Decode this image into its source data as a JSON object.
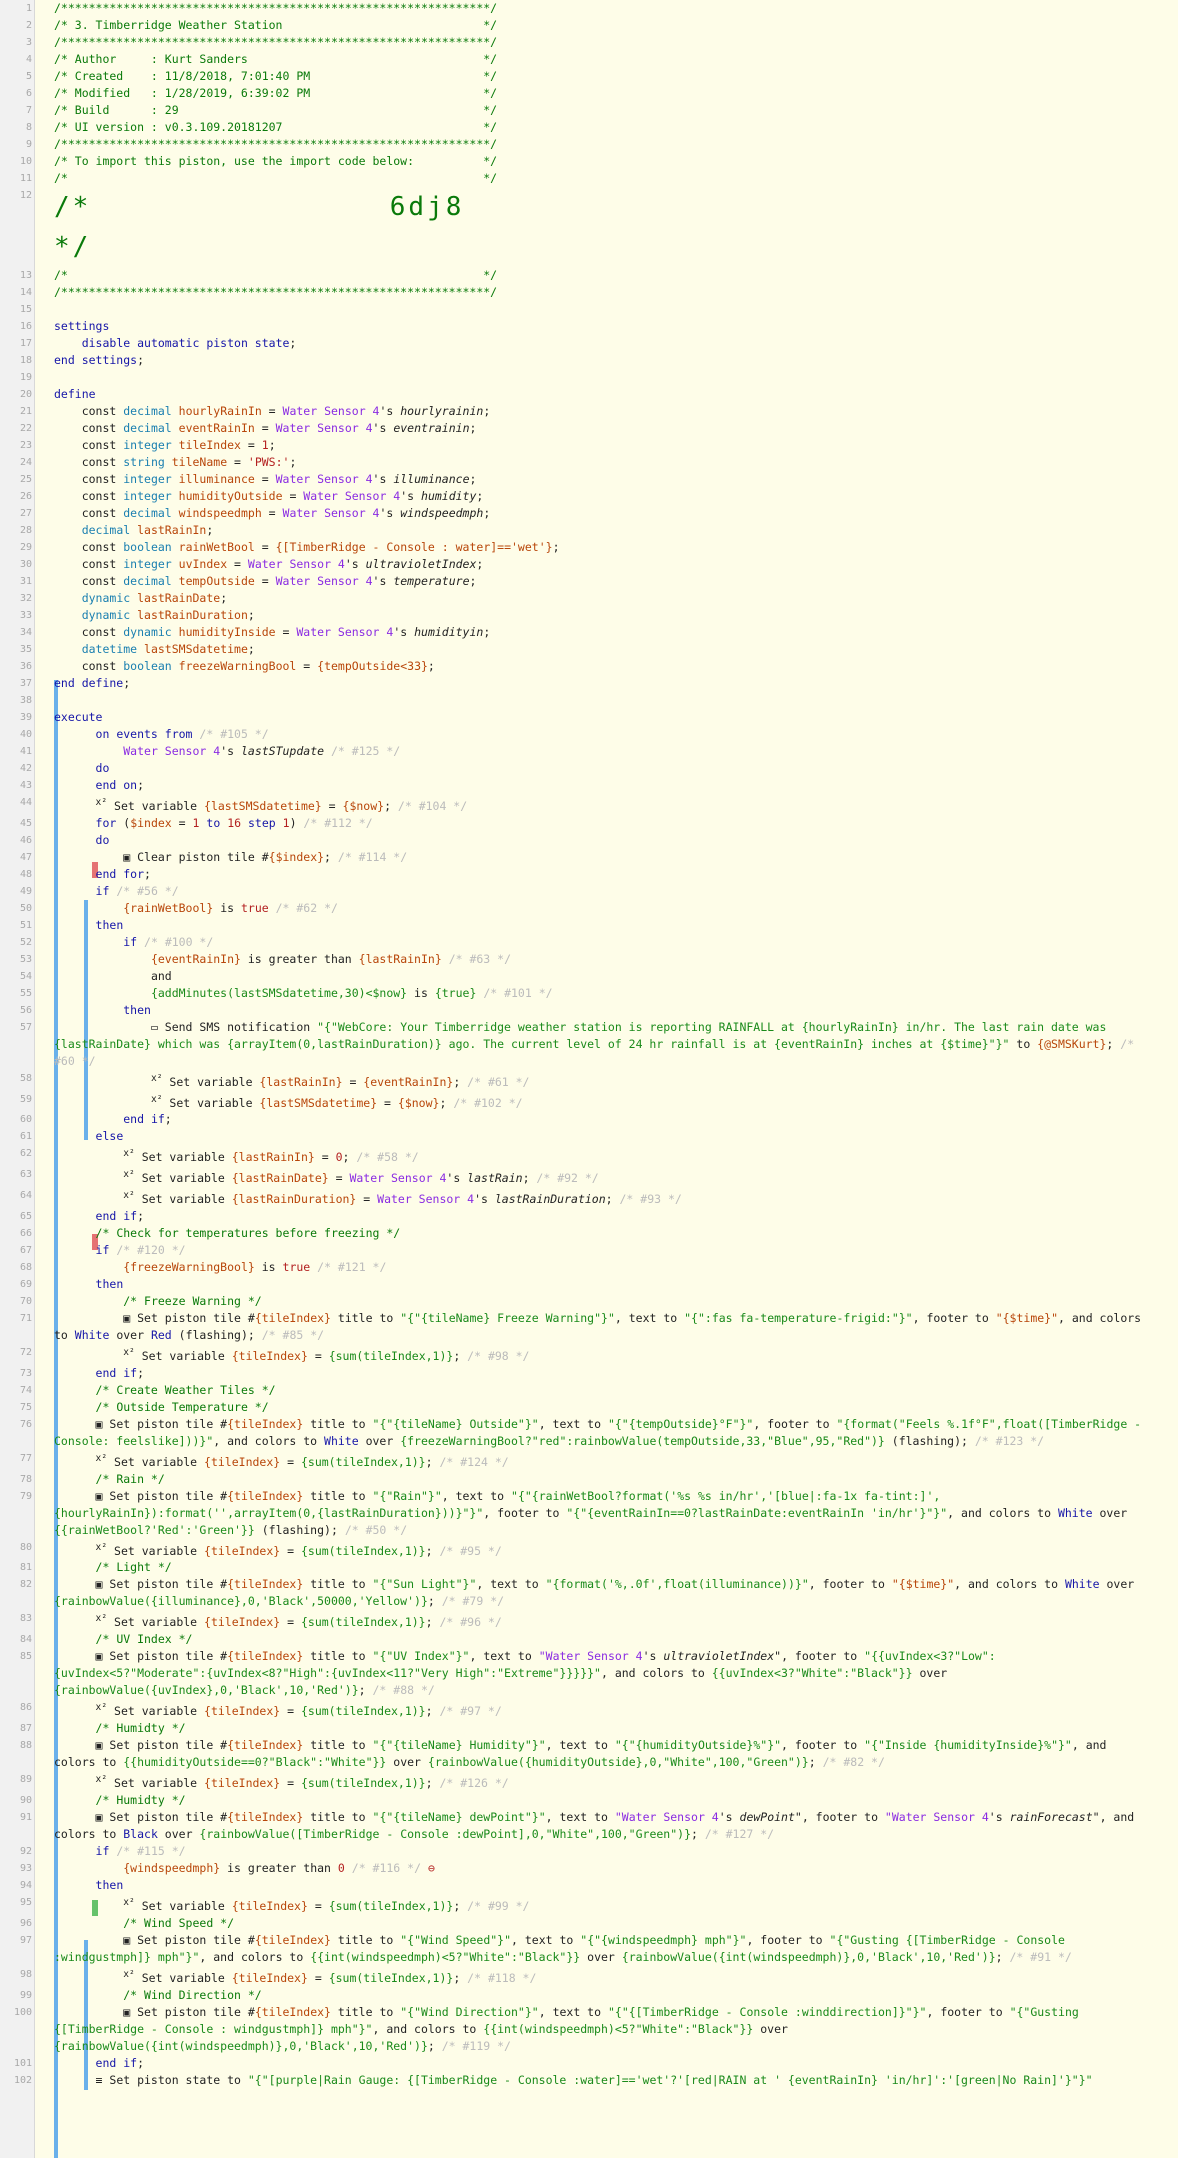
{
  "app": {
    "piston_id": "6dj8"
  },
  "lines": [
    {
      "n": "1",
      "html": "<span class='c'>/**************************************************************/</span>"
    },
    {
      "n": "2",
      "html": "<span class='c'>/* 3. Timberridge Weather Station                             */</span>"
    },
    {
      "n": "3",
      "html": "<span class='c'>/**************************************************************/</span>"
    },
    {
      "n": "4",
      "html": "<span class='c'>/* Author     : Kurt Sanders                                  */</span>"
    },
    {
      "n": "5",
      "html": "<span class='c'>/* Created    : 11/8/2018, 7:01:40 PM                         */</span>"
    },
    {
      "n": "6",
      "html": "<span class='c'>/* Modified   : 1/28/2019, 6:39:02 PM                         */</span>"
    },
    {
      "n": "7",
      "html": "<span class='c'>/* Build      : 29                                            */</span>"
    },
    {
      "n": "8",
      "html": "<span class='c'>/* UI version : v0.3.109.20181207                             */</span>"
    },
    {
      "n": "9",
      "html": "<span class='c'>/**************************************************************/</span>"
    },
    {
      "n": "10",
      "html": "<span class='c'>/* To import this piston, use the import code below:          */</span>"
    },
    {
      "n": "11",
      "html": "<span class='c'>/*                                                            */</span>"
    },
    {
      "n": "12",
      "html": "<span class='c'>/*                6dj8                                        */</span>"
    },
    {
      "n": "13",
      "html": "<span class='c'>/*                                                            */</span>"
    },
    {
      "n": "14",
      "html": "<span class='c'>/**************************************************************/</span>"
    },
    {
      "n": "15",
      "html": ""
    },
    {
      "n": "16",
      "html": "<span class='k'>settings</span>"
    },
    {
      "n": "17",
      "html": "    <span class='k'>disable automatic piston state</span>;"
    },
    {
      "n": "18",
      "html": "<span class='k'>end settings</span>;"
    },
    {
      "n": "19",
      "html": ""
    },
    {
      "n": "20",
      "html": "<span class='k'>define</span>"
    },
    {
      "n": "21",
      "html": "    const <span class='t'>decimal</span> <span class='v'>hourlyRainIn</span> = <span class='d'>Water Sensor 4</span>'s <span class='it'>hourlyrainin</span>;"
    },
    {
      "n": "22",
      "html": "    const <span class='t'>decimal</span> <span class='v'>eventRainIn</span> = <span class='d'>Water Sensor 4</span>'s <span class='it'>eventrainin</span>;"
    },
    {
      "n": "23",
      "html": "    const <span class='t'>integer</span> <span class='v'>tileIndex</span> = <span class='n'>1</span>;"
    },
    {
      "n": "24",
      "html": "    const <span class='t'>string</span> <span class='v'>tileName</span> = <span class='n'>'PWS:'</span>;"
    },
    {
      "n": "25",
      "html": "    const <span class='t'>integer</span> <span class='v'>illuminance</span> = <span class='d'>Water Sensor 4</span>'s <span class='it'>illuminance</span>;"
    },
    {
      "n": "26",
      "html": "    const <span class='t'>integer</span> <span class='v'>humidityOutside</span> = <span class='d'>Water Sensor 4</span>'s <span class='it'>humidity</span>;"
    },
    {
      "n": "27",
      "html": "    const <span class='t'>decimal</span> <span class='v'>windspeedmph</span> = <span class='d'>Water Sensor 4</span>'s <span class='it'>windspeedmph</span>;"
    },
    {
      "n": "28",
      "html": "    <span class='t'>decimal</span> <span class='v'>lastRainIn</span>;"
    },
    {
      "n": "29",
      "html": "    const <span class='t'>boolean</span> <span class='v'>rainWetBool</span> = <span class='v'>{[TimberRidge - Console : water]=='wet'}</span>;"
    },
    {
      "n": "30",
      "html": "    const <span class='t'>integer</span> <span class='v'>uvIndex</span> = <span class='d'>Water Sensor 4</span>'s <span class='it'>ultravioletIndex</span>;"
    },
    {
      "n": "31",
      "html": "    const <span class='t'>decimal</span> <span class='v'>tempOutside</span> = <span class='d'>Water Sensor 4</span>'s <span class='it'>temperature</span>;"
    },
    {
      "n": "32",
      "html": "    <span class='t'>dynamic</span> <span class='v'>lastRainDate</span>;"
    },
    {
      "n": "33",
      "html": "    <span class='t'>dynamic</span> <span class='v'>lastRainDuration</span>;"
    },
    {
      "n": "34",
      "html": "    const <span class='t'>dynamic</span> <span class='v'>humidityInside</span> = <span class='d'>Water Sensor 4</span>'s <span class='it'>humidityin</span>;"
    },
    {
      "n": "35",
      "html": "    <span class='t'>datetime</span> <span class='v'>lastSMSdatetime</span>;"
    },
    {
      "n": "36",
      "html": "    const <span class='t'>boolean</span> <span class='v'>freezeWarningBool</span> = <span class='v'>{tempOutside&lt;33}</span>;"
    },
    {
      "n": "37",
      "html": "<span class='k'>end define</span>;"
    },
    {
      "n": "38",
      "html": ""
    },
    {
      "n": "39",
      "html": "<span class='k'>execute</span>"
    },
    {
      "n": "40",
      "html": "      <span class='k'>on events from</span> <span class='cm'>/* #105 */</span>"
    },
    {
      "n": "41",
      "html": "          <span class='d'>Water Sensor 4</span>'s <span class='it'>lastSTupdate</span> <span class='cm'>/* #125 */</span>"
    },
    {
      "n": "42",
      "html": "      <span class='k'>do</span>"
    },
    {
      "n": "43",
      "html": "      <span class='k'>end on</span>;"
    },
    {
      "n": "44",
      "html": "      <sup>x²</sup> Set variable <span class='v'>{lastSMSdatetime}</span> = <span class='v'>{$now}</span>; <span class='cm'>/* #104 */</span>"
    },
    {
      "n": "45",
      "html": "      <span class='k'>for</span> (<span class='v'>$index</span> = <span class='n'>1</span> <span class='k'>to</span> <span class='n'>16</span> <span class='k'>step</span> <span class='n'>1</span>) <span class='cm'>/* #112 */</span>"
    },
    {
      "n": "46",
      "html": "      <span class='k'>do</span>"
    },
    {
      "n": "47",
      "html": "          ▣ Clear piston tile #<span class='v'>{$index}</span>; <span class='cm'>/* #114 */</span>"
    },
    {
      "n": "48",
      "html": "      <span class='k'>end for</span>;"
    },
    {
      "n": "49",
      "html": "      <span class='k'>if</span> <span class='cm'>/* #56 */</span>"
    },
    {
      "n": "50",
      "html": "          <span class='v'>{rainWetBool}</span> is <span class='n'>true</span> <span class='cm'>/* #62 */</span>"
    },
    {
      "n": "51",
      "html": "      <span class='k'>then</span>"
    },
    {
      "n": "52",
      "html": "          <span class='k'>if</span> <span class='cm'>/* #100 */</span>"
    },
    {
      "n": "53",
      "html": "              <span class='v'>{eventRainIn}</span> is greater than <span class='v'>{lastRainIn}</span> <span class='cm'>/* #63 */</span>"
    },
    {
      "n": "54",
      "html": "              and"
    },
    {
      "n": "55",
      "html": "              <span class='s'>{addMinutes(lastSMSdatetime,30)&lt;$now}</span> is <span class='s'>{true}</span> <span class='cm'>/* #101 */</span>"
    },
    {
      "n": "56",
      "html": "          <span class='k'>then</span>"
    },
    {
      "n": "57",
      "html": "              ▭ Send SMS notification <span class='s'>\"{\"WebCore: Your Timberridge weather station is reporting RAINFALL at {hourlyRainIn} in/hr. The last rain date was {lastRainDate} which was {arrayItem(0,lastRainDuration)} ago. The current level of 24 hr rainfall is at {eventRainIn} inches at {$time}\"}\"</span> to <span class='v'>{@SMSKurt}</span>; <span class='cm'>/* #60 */</span>"
    },
    {
      "n": "58",
      "html": "              <sup>x²</sup> Set variable <span class='v'>{lastRainIn}</span> = <span class='v'>{eventRainIn}</span>; <span class='cm'>/* #61 */</span>"
    },
    {
      "n": "59",
      "html": "              <sup>x²</sup> Set variable <span class='v'>{lastSMSdatetime}</span> = <span class='v'>{$now}</span>; <span class='cm'>/* #102 */</span>"
    },
    {
      "n": "60",
      "html": "          <span class='k'>end if</span>;"
    },
    {
      "n": "61",
      "html": "      <span class='k'>else</span>"
    },
    {
      "n": "62",
      "html": "          <sup>x²</sup> Set variable <span class='v'>{lastRainIn}</span> = <span class='n'>0</span>; <span class='cm'>/* #58 */</span>"
    },
    {
      "n": "63",
      "html": "          <sup>x²</sup> Set variable <span class='v'>{lastRainDate}</span> = <span class='d'>Water Sensor 4</span>'s <span class='it'>lastRain</span>; <span class='cm'>/* #92 */</span>"
    },
    {
      "n": "64",
      "html": "          <sup>x²</sup> Set variable <span class='v'>{lastRainDuration}</span> = <span class='d'>Water Sensor 4</span>'s <span class='it'>lastRainDuration</span>; <span class='cm'>/* #93 */</span>"
    },
    {
      "n": "65",
      "html": "      <span class='k'>end if</span>;"
    },
    {
      "n": "66",
      "html": "      <span class='c'>/* Check for temperatures before freezing */</span>"
    },
    {
      "n": "67",
      "html": "      <span class='k'>if</span> <span class='cm'>/* #120 */</span>"
    },
    {
      "n": "68",
      "html": "          <span class='v'>{freezeWarningBool}</span> is <span class='n'>true</span> <span class='cm'>/* #121 */</span>"
    },
    {
      "n": "69",
      "html": "      <span class='k'>then</span>"
    },
    {
      "n": "70",
      "html": "          <span class='c'>/* Freeze Warning */</span>"
    },
    {
      "n": "71",
      "html": "          ▣ Set piston tile #<span class='v'>{tileIndex}</span> title to <span class='s'>\"{\"{tileName} Freeze Warning\"}\"</span>, text to <span class='s'>\"{\":fas fa-temperature-frigid:\"}\"</span>, footer to <span class='v'>\"{$time}\"</span>, and colors to <span class='k'>White</span> over <span class='k'>Red</span> (flashing); <span class='cm'>/* #85 */</span>"
    },
    {
      "n": "72",
      "html": "          <sup>x²</sup> Set variable <span class='v'>{tileIndex}</span> = <span class='s'>{sum(tileIndex,1)}</span>; <span class='cm'>/* #98 */</span>"
    },
    {
      "n": "73",
      "html": "      <span class='k'>end if</span>;"
    },
    {
      "n": "74",
      "html": "      <span class='c'>/* Create Weather Tiles */</span>"
    },
    {
      "n": "75",
      "html": "      <span class='c'>/* Outside Temperature */</span>"
    },
    {
      "n": "76",
      "html": "      ▣ Set piston tile #<span class='v'>{tileIndex}</span> title to <span class='s'>\"{\"{tileName} Outside\"}\"</span>, text to <span class='s'>\"{\"{tempOutside}°F\"}\"</span>, footer to <span class='s'>\"{format(\"Feels %.1f°F\",float([TimberRidge - Console: feelslike]))}\"</span>, and colors to <span class='k'>White</span> over <span class='s'>{freezeWarningBool?\"red\":rainbowValue(tempOutside,33,\"Blue\",95,\"Red\")}</span> (flashing); <span class='cm'>/* #123 */</span>"
    },
    {
      "n": "77",
      "html": "      <sup>x²</sup> Set variable <span class='v'>{tileIndex}</span> = <span class='s'>{sum(tileIndex,1)}</span>; <span class='cm'>/* #124 */</span>"
    },
    {
      "n": "78",
      "html": "      <span class='c'>/* Rain */</span>"
    },
    {
      "n": "79",
      "html": "      ▣ Set piston tile #<span class='v'>{tileIndex}</span> title to <span class='s'>\"{\"Rain\"}\"</span>, text to <span class='s'>\"{\"{rainWetBool?format('%s %s in/hr','[blue|:fa-1x fa-tint:]',{hourlyRainIn}):format('',arrayItem(0,{lastRainDuration}))}\"}\"</span>, footer to <span class='s'>\"{\"{eventRainIn==0?lastRainDate:eventRainIn 'in/hr'}\"}\"</span>, and colors to <span class='k'>White</span> over <span class='s'>{{rainWetBool?'Red':'Green'}}</span> (flashing); <span class='cm'>/* #50 */</span>"
    },
    {
      "n": "80",
      "html": "      <sup>x²</sup> Set variable <span class='v'>{tileIndex}</span> = <span class='s'>{sum(tileIndex,1)}</span>; <span class='cm'>/* #95 */</span>"
    },
    {
      "n": "81",
      "html": "      <span class='c'>/* Light */</span>"
    },
    {
      "n": "82",
      "html": "      ▣ Set piston tile #<span class='v'>{tileIndex}</span> title to <span class='s'>\"{\"Sun Light\"}\"</span>, text to <span class='s'>\"{format('%,.0f',float(illuminance))}\"</span>, footer to <span class='v'>\"{$time}\"</span>, and colors to <span class='k'>White</span> over <span class='s'>{rainbowValue({illuminance},0,'Black',50000,'Yellow')}</span>; <span class='cm'>/* #79 */</span>"
    },
    {
      "n": "83",
      "html": "      <sup>x²</sup> Set variable <span class='v'>{tileIndex}</span> = <span class='s'>{sum(tileIndex,1)}</span>; <span class='cm'>/* #96 */</span>"
    },
    {
      "n": "84",
      "html": "      <span class='c'>/* UV Index */</span>"
    },
    {
      "n": "85",
      "html": "      ▣ Set piston tile #<span class='v'>{tileIndex}</span> title to <span class='s'>\"{\"UV Index\"}\"</span>, text to <span class='d'>\"Water Sensor 4</span>'s <span class='it'>ultravioletIndex</span>\", footer to <span class='s'>\"{{uvIndex&lt;3?\"Low\":{uvIndex&lt;5?\"Moderate\":{uvIndex&lt;8?\"High\":{uvIndex&lt;11?\"Very High\":\"Extreme\"}}}}}\"</span>, and colors to <span class='s'>{{uvIndex&lt;3?\"White\":\"Black\"}}</span> over <span class='s'>{rainbowValue({uvIndex},0,'Black',10,'Red')}</span>; <span class='cm'>/* #88 */</span>"
    },
    {
      "n": "86",
      "html": "      <sup>x²</sup> Set variable <span class='v'>{tileIndex}</span> = <span class='s'>{sum(tileIndex,1)}</span>; <span class='cm'>/* #97 */</span>"
    },
    {
      "n": "87",
      "html": "      <span class='c'>/* Humidty */</span>"
    },
    {
      "n": "88",
      "html": "      ▣ Set piston tile #<span class='v'>{tileIndex}</span> title to <span class='s'>\"{\"{tileName} Humidity\"}\"</span>, text to <span class='s'>\"{\"{humidityOutside}%\"}\"</span>, footer to <span class='s'>\"{\"Inside {humidityInside}%\"}\"</span>, and colors to <span class='s'>{{humidityOutside==0?\"Black\":\"White\"}}</span> over <span class='s'>{rainbowValue({humidityOutside},0,\"White\",100,\"Green\")}</span>; <span class='cm'>/* #82 */</span>"
    },
    {
      "n": "89",
      "html": "      <sup>x²</sup> Set variable <span class='v'>{tileIndex}</span> = <span class='s'>{sum(tileIndex,1)}</span>; <span class='cm'>/* #126 */</span>"
    },
    {
      "n": "90",
      "html": "      <span class='c'>/* Humidty */</span>"
    },
    {
      "n": "91",
      "html": "      ▣ Set piston tile #<span class='v'>{tileIndex}</span> title to <span class='s'>\"{\"{tileName} dewPoint\"}\"</span>, text to <span class='d'>\"Water Sensor 4</span>'s <span class='it'>dewPoint</span>\", footer to <span class='d'>\"Water Sensor 4</span>'s <span class='it'>rainForecast</span>\", and colors to <span class='k'>Black</span> over <span class='s'>{rainbowValue([TimberRidge - Console :dewPoint],0,\"White\",100,\"Green\")}</span>; <span class='cm'>/* #127 */</span>"
    },
    {
      "n": "92",
      "html": "      <span class='k'>if</span> <span class='cm'>/* #115 */</span>"
    },
    {
      "n": "93",
      "html": "          <span class='v'>{windspeedmph}</span> is greater than <span class='n'>0</span> <span class='cm'>/* #116 */</span> <span class='n'>⊖</span>"
    },
    {
      "n": "94",
      "html": "      <span class='k'>then</span>"
    },
    {
      "n": "95",
      "html": "          <sup>x²</sup> Set variable <span class='v'>{tileIndex}</span> = <span class='s'>{sum(tileIndex,1)}</span>; <span class='cm'>/* #99 */</span>"
    },
    {
      "n": "96",
      "html": "          <span class='c'>/* Wind Speed */</span>"
    },
    {
      "n": "97",
      "html": "          ▣ Set piston tile #<span class='v'>{tileIndex}</span> title to <span class='s'>\"{\"Wind Speed\"}\"</span>, text to <span class='s'>\"{\"{windspeedmph} mph\"}\"</span>, footer to <span class='s'>\"{\"Gusting {[TimberRidge - Console :windgustmph]} mph\"}\"</span>, and colors to <span class='s'>{{int(windspeedmph)&lt;5?\"White\":\"Black\"}}</span> over <span class='s'>{rainbowValue({int(windspeedmph)},0,'Black',10,'Red')}</span>; <span class='cm'>/* #91 */</span>"
    },
    {
      "n": "98",
      "html": "          <sup>x²</sup> Set variable <span class='v'>{tileIndex}</span> = <span class='s'>{sum(tileIndex,1)}</span>; <span class='cm'>/* #118 */</span>"
    },
    {
      "n": "99",
      "html": "          <span class='c'>/* Wind Direction */</span>"
    },
    {
      "n": "100",
      "html": "          ▣ Set piston tile #<span class='v'>{tileIndex}</span> title to <span class='s'>\"{\"Wind Direction\"}\"</span>, text to <span class='s'>\"{\"{[TimberRidge - Console :winddirection]}\"}\"</span>, footer to <span class='s'>\"{\"Gusting {[TimberRidge - Console : windgustmph]} mph\"}\"</span>, and colors to <span class='s'>{{int(windspeedmph)&lt;5?\"White\":\"Black\"}}</span> over <span class='s'>{rainbowValue({int(windspeedmph)},0,'Black',10,'Red')}</span>; <span class='cm'>/* #119 */</span>"
    },
    {
      "n": "101",
      "html": "      <span class='k'>end if</span>;"
    },
    {
      "n": "102",
      "html": "      ≡ Set piston state to <span class='s'>\"{\"[purple|Rain Gauge: {[TimberRidge - Console :water]=='wet'?'[red|RAIN at ' {eventRainIn} 'in/hr]':'[green|No Rain]'}\"}\"</span>"
    }
  ]
}
